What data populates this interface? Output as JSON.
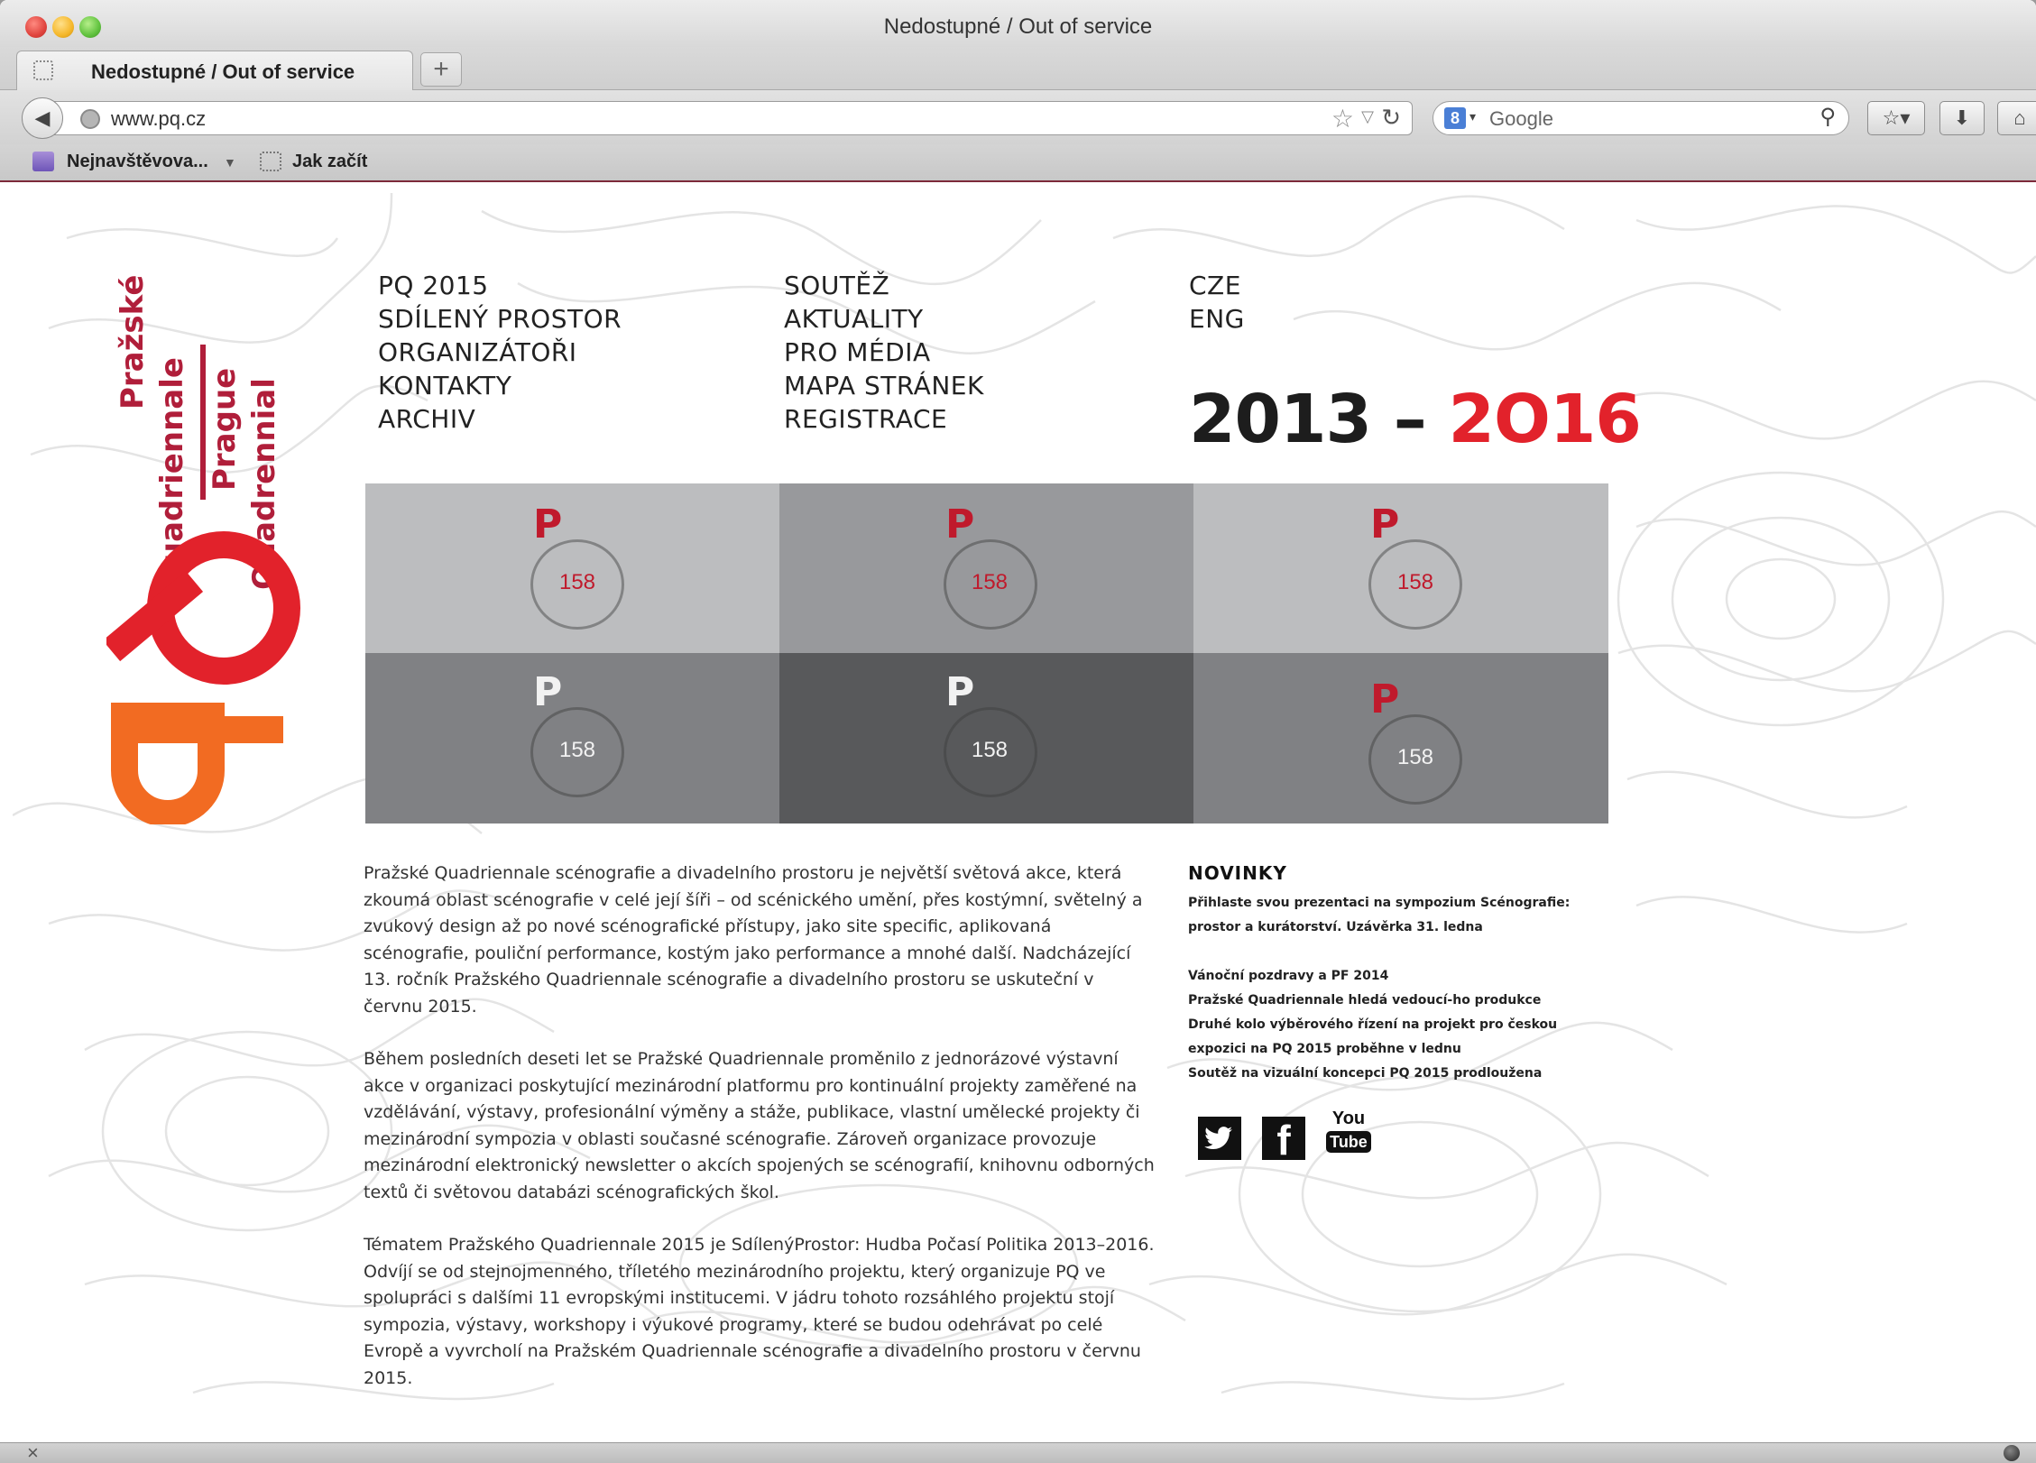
{
  "window": {
    "title": "Nedostupné / Out of service"
  },
  "tab": {
    "label": "Nedostupné / Out of service",
    "new_tab": "+"
  },
  "navbar": {
    "url": "www.pq.cz",
    "search_engine_glyph": "8",
    "search_placeholder": "Google"
  },
  "bookmarks": {
    "most_visited": "Nejnavštěvova...",
    "getting_started": "Jak začít"
  },
  "logo": {
    "line1": "Pražské",
    "line2": "Quadriennale",
    "line3": "Prague",
    "line4": "Quadrennial",
    "mark": "PQ",
    "colors": {
      "red": "#e2222b",
      "orange": "#f26b22",
      "crimson": "#b01e3a"
    }
  },
  "menu": {
    "col1": [
      "PQ 2015",
      "SDÍLENÝ PROSTOR",
      "ORGANIZÁTOŘI",
      "KONTAKTY",
      "ARCHIV"
    ],
    "col2": [
      "SOUTĚŽ",
      "AKTUALITY",
      "PRO MÉDIA",
      "MAPA STRÁNEK",
      "REGISTRACE"
    ],
    "languages": [
      "CZE",
      "ENG"
    ]
  },
  "years": {
    "start": "2013",
    "dash": "–",
    "end_a": "2",
    "end_b": "O",
    "end_c": "16"
  },
  "grid": {
    "cells": [
      {
        "letter": "P",
        "number": "158",
        "bg": "#bcbdbf",
        "letter_color": "#c01a2c",
        "number_color": "#c01a2c"
      },
      {
        "letter": "P",
        "number": "158",
        "bg": "#98999c",
        "letter_color": "#c01a2c",
        "number_color": "#c01a2c"
      },
      {
        "letter": "P",
        "number": "158",
        "bg": "#bcbdbf",
        "letter_color": "#c01a2c",
        "number_color": "#c01a2c"
      },
      {
        "letter": "P",
        "number": "158",
        "bg": "#808184",
        "letter_color": "#f2f2f2",
        "number_color": "#f2f2f2"
      },
      {
        "letter": "P",
        "number": "158",
        "bg": "#58595b",
        "letter_color": "#f2f2f2",
        "number_color": "#f2f2f2"
      },
      {
        "letter": "P",
        "number": "158",
        "bg": "#808184",
        "letter_color": "#c01a2c",
        "number_color": "#f2f2f2"
      }
    ]
  },
  "body": {
    "p1": "Pražské Quadriennale scénografie a divadelního prostoru je největší světová akce, která zkoumá oblast scénografie v celé její šíři – od scénického umění, přes kostýmní, světelný a zvukový design až po nové scénografické přístupy, jako site specific, aplikovaná scénografie, pouliční performance, kostým jako performance a mnohé další. Nadcházející 13. ročník Pražského Quadriennale scénografie a divadelního prostoru se uskuteční v červnu 2015.",
    "p2": "Během posledních deseti let se Pražské Quadriennale proměnilo z jednorázové výstavní akce v organizaci poskytující mezinárodní platformu pro kontinuální projekty zaměřené na vzdělávání, výstavy, profesionální výměny a stáže, publikace, vlastní umělecké projekty či mezinárodní sympozia v oblasti současné scénografie. Zároveň organizace provozuje mezinárodní elektronický newsletter o akcích spojených se scénografií, knihovnu odborných textů či světovou databázi scénografických škol.",
    "p3": "Tématem Pražského Quadriennale 2015 je SdílenýProstor: Hudba Počasí Politika 2013–2016. Odvíjí se od stejnojmenného, tříletého mezinárodního projektu, který organizuje PQ ve spolupráci s dalšími 11 evropskými institucemi. V jádru tohoto rozsáhlého projektu stojí sympozia, výstavy, workshopy i výukové programy, které se budou odehrávat po celé Evropě a vyvrcholí na Pražském Quadriennale scénografie a divadelního prostoru v červnu 2015."
  },
  "news": {
    "title": "NOVINKY",
    "item1": "Přihlaste svou prezentaci na sympozium Scénografie: prostor a kurátorství. Uzávěrka 31. ledna",
    "item2": "Vánoční pozdravy a PF 2014",
    "item3": "Pražské Quadriennale hledá vedoucí-ho produkce",
    "item4": "Druhé kolo výběrového řízení na projekt pro českou expozici na PQ 2015 proběhne v lednu",
    "item5": "Soutěž na vizuální koncepci PQ 2015 prodloužena"
  },
  "social": {
    "twitter_icon": "twitter-icon",
    "facebook_glyph": "f",
    "youtube_top": "You",
    "youtube_bottom": "Tube"
  },
  "statusbar": {
    "close_glyph": "×"
  }
}
